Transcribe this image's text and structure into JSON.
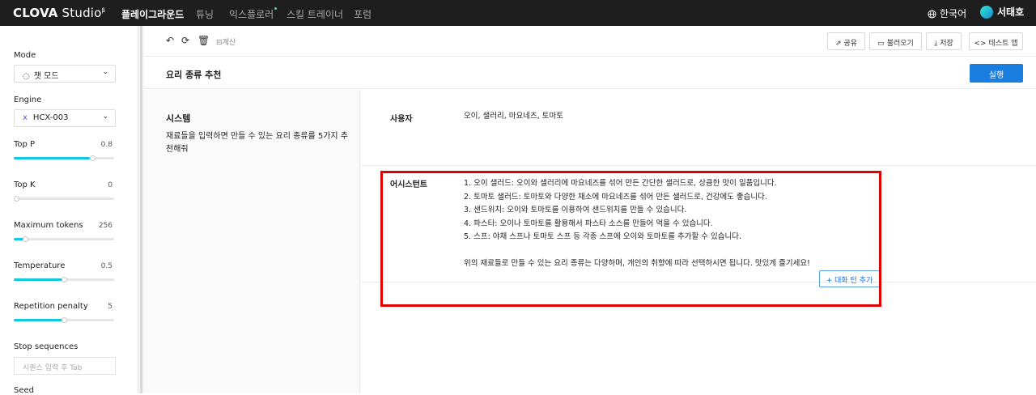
{
  "topbar": {
    "logo_bold": "CLOVA",
    "logo_light": " Studio",
    "logo_sup": "β",
    "nav": [
      "플레이그라운드",
      "튜닝",
      "익스플로러",
      "스킬 트레이너",
      "포럼"
    ],
    "language": "한국어",
    "user_name": "서태호"
  },
  "sidebar": {
    "mode_label": "Mode",
    "mode_value": "챗 모드",
    "engine_label": "Engine",
    "engine_value": "HCX-003",
    "params": [
      {
        "label": "Top P",
        "value": "0.8",
        "level": 0.8
      },
      {
        "label": "Top K",
        "value": "0",
        "level": 0.0
      },
      {
        "label": "Maximum tokens",
        "value": "256",
        "level": 0.1
      },
      {
        "label": "Temperature",
        "value": "0.5",
        "level": 0.5
      },
      {
        "label": "Repetition penalty",
        "value": "5",
        "level": 0.5
      }
    ],
    "stop_label": "Stop sequences",
    "stop_placeholder": "시퀀스 입력 후 Tab",
    "seed_label": "Seed"
  },
  "toolbar": {
    "calc_label": "계산",
    "share": "공유",
    "load": "불러오기",
    "save": "저장",
    "test_app": "테스트 앱"
  },
  "page": {
    "title": "요리 종류 추천",
    "run": "실행",
    "system_heading": "시스템",
    "system_text": "재료들을 입력하면 만들 수 있는 요리 종류를 5가지 추천해줘",
    "user_role": "사용자",
    "user_message": "오이, 샐러리, 마요네즈, 토마토",
    "assistant_role": "어시스턴트",
    "assistant_lines": [
      "1. 오이 샐러드: 오이와 샐러리에 마요네즈를 섞어 만든 간단한 샐러드로, 상큼한 맛이 일품입니다.",
      "2. 토마토 샐러드: 토마토와 다양한 채소에 마요네즈를 섞어 만든 샐러드로, 건강에도 좋습니다.",
      "3. 샌드위치: 오이와 토마토를 이용하여 샌드위치를 만들 수 있습니다.",
      "4. 파스타: 오이나 토마토를 활용해서 파스타 소스를 만들어 먹을 수 있습니다.",
      "5. 스프: 야채 스프나 토마토 스프 등 각종 스프에 오이와 토마토를 추가할 수 있습니다.",
      "",
      "위의 재료들로 만들 수 있는 요리 종류는 다양하며, 개인의 취향에 따라 선택하시면 됩니다. 맛있게 즐기세요!"
    ],
    "add_turn": "+ 대화 턴 추가"
  },
  "colors": {
    "topbar_bg": "#1e1e1e",
    "accent": "#12c8e0",
    "run_button": "#1a7de0",
    "highlight_box": "#e00000"
  }
}
